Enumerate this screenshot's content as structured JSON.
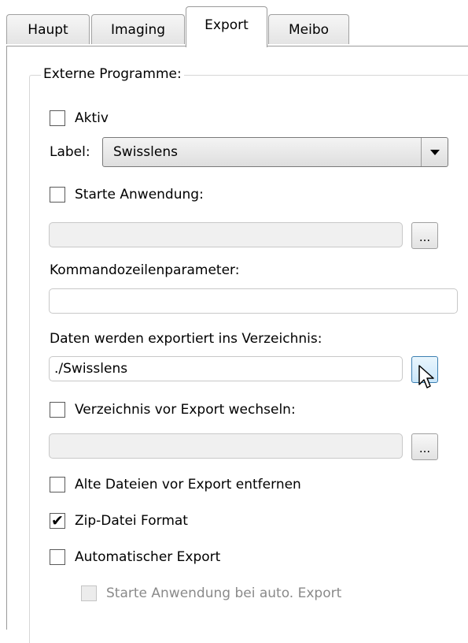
{
  "tabs": [
    "Haupt",
    "Imaging",
    "Export",
    "Meibo"
  ],
  "active_tab": "Export",
  "group_title": "Externe Programme:",
  "aktiv": {
    "label": "Aktiv",
    "checked": false
  },
  "label_row": {
    "label": "Label:",
    "value": "Swisslens"
  },
  "starte_anwendung": {
    "label": "Starte Anwendung:",
    "checked": false,
    "path": ""
  },
  "browse_label": "...",
  "kommandozeile": {
    "label": "Kommandozeilenparameter:",
    "value": ""
  },
  "export_dir": {
    "label": "Daten werden exportiert ins Verzeichnis:",
    "value": "./Swisslens"
  },
  "verzeichnis_wechseln": {
    "label": "Verzeichnis vor Export wechseln:",
    "checked": false,
    "path": ""
  },
  "alte_dateien": {
    "label": "Alte Dateien vor Export entfernen",
    "checked": false
  },
  "zip_format": {
    "label": "Zip-Datei Format",
    "checked": true
  },
  "auto_export": {
    "label": "Automatischer Export",
    "checked": false
  },
  "auto_starte": {
    "label": "Starte Anwendung bei auto. Export",
    "checked": false,
    "disabled": true
  }
}
